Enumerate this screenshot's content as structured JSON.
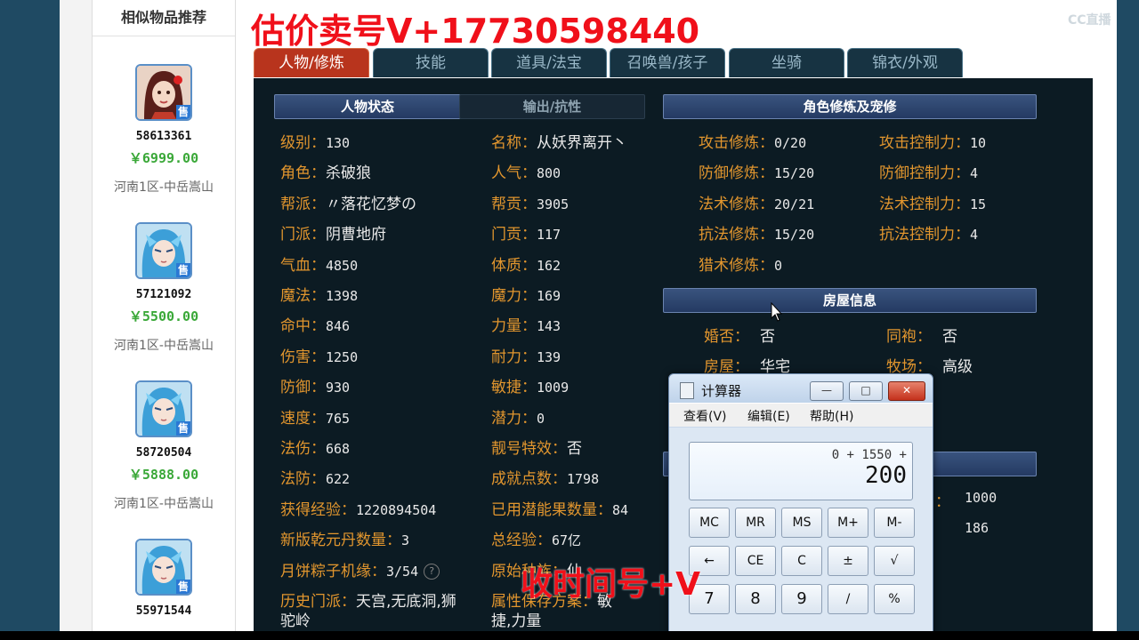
{
  "overlays": {
    "top_text": "估价卖号V+17730598440",
    "bottom_text": "收时间号+V",
    "sub_text": "",
    "logo": "CC直播"
  },
  "sidebar": {
    "title": "相似物品推荐",
    "items": [
      {
        "id": "58613361",
        "price": "￥6999.00",
        "server": "河南1区-中岳嵩山",
        "badge": "售",
        "avatar": "red-hair-female-icon"
      },
      {
        "id": "57121092",
        "price": "￥5500.00",
        "server": "河南1区-中岳嵩山",
        "badge": "售",
        "avatar": "blue-hair-male-icon"
      },
      {
        "id": "58720504",
        "price": "￥5888.00",
        "server": "河南1区-中岳嵩山",
        "badge": "售",
        "avatar": "blue-hair-male-icon"
      },
      {
        "id": "55971544",
        "price": "",
        "server": "",
        "badge": "售",
        "avatar": "blue-hair-male-icon"
      }
    ]
  },
  "tabs": [
    "人物/修炼",
    "技能",
    "道具/法宝",
    "召唤兽/孩子",
    "坐骑",
    "锦衣/外观"
  ],
  "sections": {
    "status": "人物状态",
    "output": "输出/抗性",
    "cultivation": "角色修炼及宠修",
    "house": "房屋信息"
  },
  "stats_left": [
    {
      "label": "级别：",
      "value": "130"
    },
    {
      "label": "角色：",
      "value": "杀破狼"
    },
    {
      "label": "帮派：",
      "value": "〃落花忆梦の"
    },
    {
      "label": "门派：",
      "value": "阴曹地府"
    },
    {
      "label": "气血：",
      "value": "4850"
    },
    {
      "label": "魔法：",
      "value": "1398"
    },
    {
      "label": "命中：",
      "value": "846"
    },
    {
      "label": "伤害：",
      "value": "1250"
    },
    {
      "label": "防御：",
      "value": "930"
    },
    {
      "label": "速度：",
      "value": "765"
    },
    {
      "label": "法伤：",
      "value": "668"
    },
    {
      "label": "法防：",
      "value": "622"
    },
    {
      "label": "获得经验：",
      "value": "1220894504"
    },
    {
      "label": "新版乾元丹数量：",
      "value": "3"
    },
    {
      "label": "月饼粽子机缘：",
      "value": "3/54"
    },
    {
      "label": "历史门派：",
      "value": "天宫,无底洞,狮"
    },
    {
      "label": "",
      "value": "驼岭"
    }
  ],
  "stats_right": [
    {
      "label": "名称：",
      "value": "从妖界离开丶"
    },
    {
      "label": "人气：",
      "value": "800"
    },
    {
      "label": "帮贡：",
      "value": "3905"
    },
    {
      "label": "门贡：",
      "value": "117"
    },
    {
      "label": "体质：",
      "value": "162"
    },
    {
      "label": "魔力：",
      "value": "169"
    },
    {
      "label": "力量：",
      "value": "143"
    },
    {
      "label": "耐力：",
      "value": "139"
    },
    {
      "label": "敏捷：",
      "value": "1009"
    },
    {
      "label": "潜力：",
      "value": "0"
    },
    {
      "label": "靓号特效：",
      "value": "否"
    },
    {
      "label": "成就点数：",
      "value": "1798"
    },
    {
      "label": "已用潜能果数量：",
      "value": "84"
    },
    {
      "label": "总经验：",
      "value": "67亿"
    },
    {
      "label": "原始种族：",
      "value": "仙"
    },
    {
      "label": "属性保存方案：",
      "value": "敏"
    },
    {
      "label": "",
      "value": "捷,力量"
    }
  ],
  "cultivation": [
    {
      "label": "攻击修炼：",
      "value": "0/20"
    },
    {
      "label": "防御修炼：",
      "value": "15/20"
    },
    {
      "label": "法术修炼：",
      "value": "20/21"
    },
    {
      "label": "抗法修炼：",
      "value": "15/20"
    },
    {
      "label": "猎术修炼：",
      "value": "0"
    }
  ],
  "control": [
    {
      "label": "攻击控制力：",
      "value": "10"
    },
    {
      "label": "防御控制力：",
      "value": "4"
    },
    {
      "label": "法术控制力：",
      "value": "15"
    },
    {
      "label": "抗法控制力：",
      "value": "4"
    }
  ],
  "house": [
    {
      "label": "婚否：",
      "value": "否"
    },
    {
      "label": "同袍：",
      "value": "否"
    },
    {
      "label": "房屋：",
      "value": "华宅"
    },
    {
      "label": "牧场：",
      "value": "高级"
    }
  ],
  "partial_values": [
    "1000",
    "186"
  ],
  "calculator": {
    "title": "计算器",
    "menu": [
      "查看(V)",
      "编辑(E)",
      "帮助(H)"
    ],
    "expression": "0 + 1550 +",
    "result": "200",
    "keys": [
      [
        "MC",
        "MR",
        "MS",
        "M+",
        "M-"
      ],
      [
        "←",
        "CE",
        "C",
        "±",
        "√"
      ],
      [
        "7",
        "8",
        "9",
        "/",
        "%"
      ]
    ]
  }
}
